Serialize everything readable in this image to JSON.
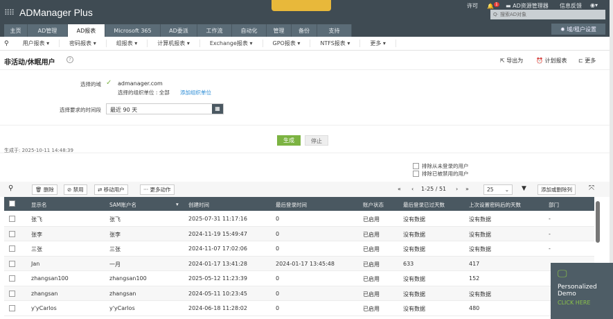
{
  "app": {
    "name": "ADManager Plus"
  },
  "header": {
    "license": "许可",
    "notif_count": "1",
    "ad_explorer": "AD资源管理器",
    "feedback": "信息反馈",
    "search_placeholder": "搜索AD对象",
    "settings": "域/租户设置"
  },
  "tabs": [
    "主页",
    "AD管理",
    "AD报表",
    "Microsoft 365",
    "AD委派",
    "工作流",
    "自动化",
    "管理",
    "备份",
    "支持"
  ],
  "subnav": [
    "用户报表",
    "密码报表",
    "组报表",
    "计算机报表",
    "Exchange报表",
    "GPO报表",
    "NTFS报表",
    "更多"
  ],
  "page": {
    "title": "非活动/休眠用户",
    "export": "导出为",
    "schedule": "计划报表",
    "more": "更多"
  },
  "form": {
    "domain_label": "选择的域",
    "domain": "admanager.com",
    "ou_text": "选择的组织单位 : 全部",
    "add_ou": "添加组织单位",
    "period_label": "选择要求的时间段",
    "period": "最近 90 天",
    "generate": "生成",
    "stop": "停止"
  },
  "generated_at": "生成于: 2025-10-11 14:48:39",
  "filters": [
    "排除从未登录的用户",
    "排除已被禁用的用户"
  ],
  "toolbar": {
    "delete": "删除",
    "disable": "禁用",
    "move": "移动用户",
    "more": "更多动作",
    "pagination": "1-25 / 51",
    "page_size": "25",
    "add_remove_cols": "添加或删除列"
  },
  "columns": [
    "显示名",
    "SAM账户名",
    "创建时间",
    "最后登录时间",
    "账户状态",
    "最后登录已过天数",
    "上次设置密码后的天数",
    "部门"
  ],
  "rows": [
    [
      "张飞",
      "张飞",
      "2025-07-31 11:17:16",
      "0",
      "已启用",
      "没有数据",
      "没有数据",
      "-"
    ],
    [
      "张李",
      "张李",
      "2024-11-19 15:49:47",
      "0",
      "已启用",
      "没有数据",
      "没有数据",
      "-"
    ],
    [
      "三张",
      "三张",
      "2024-11-07 17:02:06",
      "0",
      "已启用",
      "没有数据",
      "没有数据",
      "-"
    ],
    [
      "Jan",
      "一月",
      "2024-01-17 13:41:28",
      "2024-01-17 13:45:48",
      "已启用",
      "633",
      "417",
      ""
    ],
    [
      "zhangsan100",
      "zhangsan100",
      "2025-05-12 11:23:39",
      "0",
      "已启用",
      "没有数据",
      "152",
      ""
    ],
    [
      "zhangsan",
      "zhangsan",
      "2024-05-11 10:23:45",
      "0",
      "已启用",
      "没有数据",
      "没有数据",
      ""
    ],
    [
      "y'yCarlos",
      "y'yCarlos",
      "2024-06-18 11:28:02",
      "0",
      "已启用",
      "没有数据",
      "480",
      ""
    ]
  ],
  "demo": {
    "line1": "Personalized",
    "line2": "Demo",
    "cta": "CLICK HERE"
  }
}
